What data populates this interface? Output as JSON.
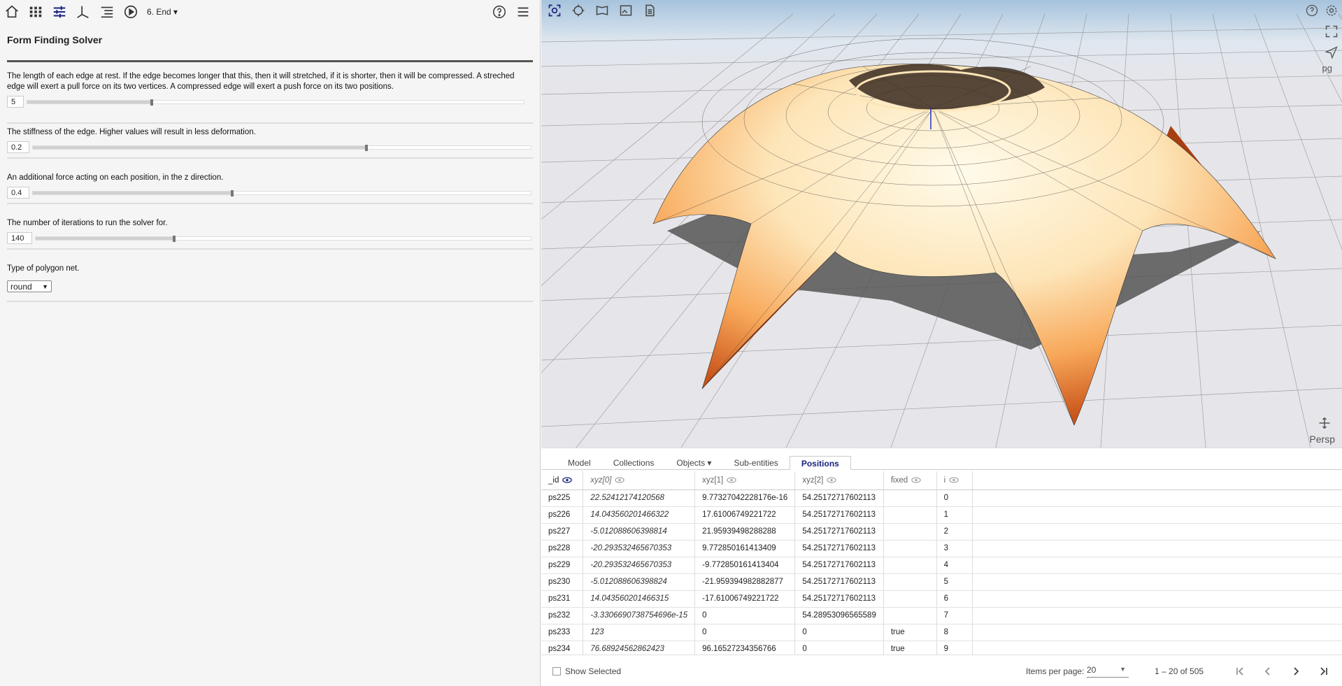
{
  "toolbar": {
    "icons": [
      "home-icon",
      "grid-icon",
      "sliders-icon",
      "axis-icon",
      "list-icon",
      "play-icon"
    ],
    "flow_select": "6. End ▾",
    "right_icons": [
      "help-icon",
      "menu-icon"
    ]
  },
  "panel": {
    "title": "Form Finding Solver",
    "params": [
      {
        "desc": "The length of each edge at rest. If the edge becomes longer that this, then it will stretched, if it is shorter, then it will be compressed. A streched edge will exert a pull force on its two vertices. A compressed edge will exert a push force on its two positions.",
        "value": "5",
        "slider_fraction": 0.25
      },
      {
        "desc": "The stiffness of the edge. Higher values will result in less deformation.",
        "value": "0.2",
        "slider_fraction": 0.67
      },
      {
        "desc": "An additional force acting on each position, in the z direction.",
        "value": "0.4",
        "slider_fraction": 0.4
      },
      {
        "desc": "The number of iterations to run the solver for.",
        "value": "140",
        "slider_fraction": 0.28
      }
    ],
    "net_type_label": "Type of polygon net.",
    "net_type_value": "round"
  },
  "viewport": {
    "left_icons": [
      "zoom-fit-icon",
      "target-icon",
      "view-icon",
      "image-icon",
      "document-icon"
    ],
    "right_icons": [
      "help-icon",
      "settings-icon",
      "fullscreen-icon",
      "send-icon"
    ],
    "pg_label": "pg",
    "persp_label": "Persp"
  },
  "tabs": [
    {
      "label": "Model",
      "active": false
    },
    {
      "label": "Collections",
      "active": false
    },
    {
      "label": "Objects ▾",
      "active": false
    },
    {
      "label": "Sub-entities",
      "active": false
    },
    {
      "label": "Positions",
      "active": true
    }
  ],
  "table": {
    "columns": [
      "_id",
      "xyz[0]",
      "xyz[1]",
      "xyz[2]",
      "fixed",
      "i"
    ],
    "rows": [
      [
        "ps225",
        "22.52412174120568",
        "9.77327042228176e-16",
        "54.25172717602113",
        "",
        "0"
      ],
      [
        "ps226",
        "14.043560201466322",
        "17.61006749221722",
        "54.25172717602113",
        "",
        "1"
      ],
      [
        "ps227",
        "-5.012088606398814",
        "21.95939498288288",
        "54.25172717602113",
        "",
        "2"
      ],
      [
        "ps228",
        "-20.293532465670353",
        "9.772850161413409",
        "54.25172717602113",
        "",
        "3"
      ],
      [
        "ps229",
        "-20.293532465670353",
        "-9.772850161413404",
        "54.25172717602113",
        "",
        "4"
      ],
      [
        "ps230",
        "-5.012088606398824",
        "-21.959394982882877",
        "54.25172717602113",
        "",
        "5"
      ],
      [
        "ps231",
        "14.043560201466315",
        "-17.61006749221722",
        "54.25172717602113",
        "",
        "6"
      ],
      [
        "ps232",
        "-3.3306690738754696e-15",
        "0",
        "54.28953096565589",
        "",
        "7"
      ],
      [
        "ps233",
        "123",
        "0",
        "0",
        "true",
        "8"
      ],
      [
        "ps234",
        "76.68924562862423",
        "96.16527234356766",
        "0",
        "true",
        "9"
      ]
    ]
  },
  "paginator": {
    "show_selected": "Show Selected",
    "items_per_page_label": "Items per page:",
    "items_per_page": "20",
    "range": "1 – 20 of 505"
  },
  "colors": {
    "accent": "#1a237e",
    "surface_light": "#fde9c4",
    "surface_dark": "#9a3306"
  }
}
